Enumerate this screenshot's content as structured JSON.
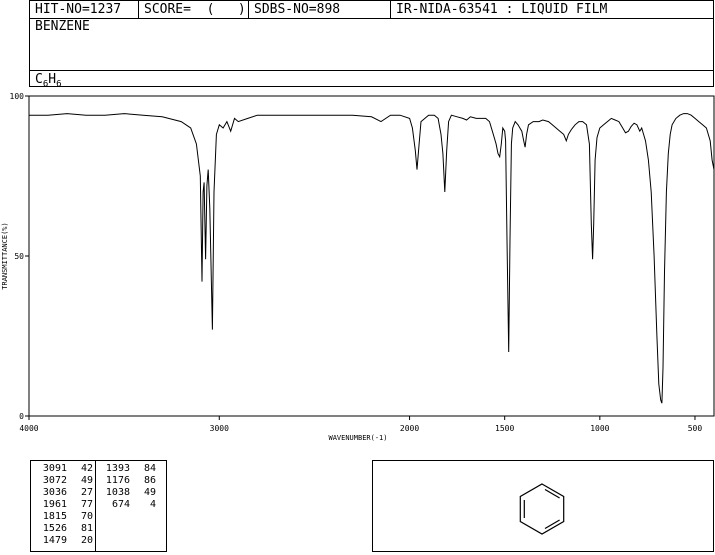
{
  "header": {
    "hit_no": "HIT-NO=1237",
    "score": "SCORE=  (   )",
    "sdbs_no": "SDBS-NO=898",
    "ir_info": "IR-NIDA-63541 : LIQUID FILM",
    "compound_name": "BENZENE",
    "formula": {
      "c": "C",
      "c_sub": "6",
      "h": "H",
      "h_sub": "6"
    }
  },
  "chart_data": {
    "type": "line",
    "xlabel": "WAVENUMBER(-1)",
    "ylabel": "TRANSMITTANCE(%)",
    "xlim": [
      4000,
      400
    ],
    "ylim": [
      0,
      100
    ],
    "x_ticks": [
      4000,
      3000,
      2000,
      1500,
      1000,
      500
    ],
    "y_ticks": [
      0,
      50,
      100
    ],
    "grid": false,
    "baseline": [
      [
        4000,
        94
      ],
      [
        3900,
        94
      ],
      [
        3800,
        94.5
      ],
      [
        3700,
        94
      ],
      [
        3600,
        94
      ],
      [
        3500,
        94.5
      ],
      [
        3400,
        94
      ],
      [
        3300,
        93.5
      ],
      [
        3200,
        92
      ],
      [
        3150,
        90
      ],
      [
        3120,
        85
      ],
      [
        3100,
        75
      ],
      [
        3091,
        42
      ],
      [
        3085,
        70
      ],
      [
        3080,
        73
      ],
      [
        3072,
        49
      ],
      [
        3065,
        72
      ],
      [
        3058,
        77
      ],
      [
        3050,
        65
      ],
      [
        3036,
        27
      ],
      [
        3028,
        70
      ],
      [
        3015,
        88
      ],
      [
        3000,
        91
      ],
      [
        2980,
        90
      ],
      [
        2960,
        92
      ],
      [
        2940,
        89
      ],
      [
        2920,
        93
      ],
      [
        2900,
        92
      ],
      [
        2850,
        93
      ],
      [
        2800,
        94
      ],
      [
        2700,
        94
      ],
      [
        2600,
        94
      ],
      [
        2500,
        94
      ],
      [
        2400,
        94
      ],
      [
        2300,
        94
      ],
      [
        2200,
        93.5
      ],
      [
        2150,
        92
      ],
      [
        2100,
        94
      ],
      [
        2050,
        94
      ],
      [
        2000,
        93
      ],
      [
        1985,
        90
      ],
      [
        1970,
        83
      ],
      [
        1961,
        77
      ],
      [
        1950,
        85
      ],
      [
        1940,
        92
      ],
      [
        1900,
        94
      ],
      [
        1870,
        94
      ],
      [
        1850,
        93
      ],
      [
        1835,
        88
      ],
      [
        1825,
        82
      ],
      [
        1815,
        70
      ],
      [
        1805,
        83
      ],
      [
        1795,
        92
      ],
      [
        1780,
        94
      ],
      [
        1750,
        93.5
      ],
      [
        1720,
        93
      ],
      [
        1700,
        92.5
      ],
      [
        1680,
        93.5
      ],
      [
        1650,
        93
      ],
      [
        1620,
        93
      ],
      [
        1600,
        93
      ],
      [
        1580,
        92
      ],
      [
        1560,
        88
      ],
      [
        1545,
        85
      ],
      [
        1535,
        82
      ],
      [
        1526,
        81
      ],
      [
        1518,
        85
      ],
      [
        1510,
        90
      ],
      [
        1500,
        89
      ],
      [
        1495,
        86
      ],
      [
        1488,
        55
      ],
      [
        1479,
        20
      ],
      [
        1472,
        55
      ],
      [
        1465,
        85
      ],
      [
        1458,
        90
      ],
      [
        1445,
        92
      ],
      [
        1430,
        91
      ],
      [
        1410,
        89
      ],
      [
        1400,
        86
      ],
      [
        1393,
        84
      ],
      [
        1385,
        88
      ],
      [
        1375,
        91
      ],
      [
        1350,
        92
      ],
      [
        1320,
        92
      ],
      [
        1300,
        92.5
      ],
      [
        1270,
        92
      ],
      [
        1250,
        91
      ],
      [
        1230,
        90
      ],
      [
        1210,
        89
      ],
      [
        1190,
        88
      ],
      [
        1176,
        86
      ],
      [
        1165,
        88
      ],
      [
        1150,
        89.5
      ],
      [
        1130,
        91
      ],
      [
        1110,
        92
      ],
      [
        1090,
        92
      ],
      [
        1070,
        91
      ],
      [
        1055,
        85
      ],
      [
        1045,
        60
      ],
      [
        1038,
        49
      ],
      [
        1032,
        60
      ],
      [
        1025,
        80
      ],
      [
        1015,
        87
      ],
      [
        1000,
        90
      ],
      [
        980,
        91
      ],
      [
        960,
        92
      ],
      [
        940,
        93
      ],
      [
        920,
        92.5
      ],
      [
        900,
        92
      ],
      [
        880,
        90
      ],
      [
        865,
        88.5
      ],
      [
        850,
        89
      ],
      [
        835,
        90.5
      ],
      [
        820,
        91.5
      ],
      [
        805,
        91
      ],
      [
        790,
        89
      ],
      [
        780,
        90
      ],
      [
        770,
        88
      ],
      [
        760,
        86
      ],
      [
        745,
        80
      ],
      [
        730,
        70
      ],
      [
        715,
        50
      ],
      [
        700,
        25
      ],
      [
        690,
        10
      ],
      [
        680,
        5
      ],
      [
        674,
        4
      ],
      [
        668,
        15
      ],
      [
        660,
        45
      ],
      [
        650,
        70
      ],
      [
        640,
        82
      ],
      [
        630,
        88
      ],
      [
        620,
        91
      ],
      [
        600,
        93
      ],
      [
        580,
        94
      ],
      [
        560,
        94.5
      ],
      [
        540,
        94.5
      ],
      [
        520,
        94
      ],
      [
        500,
        93
      ],
      [
        480,
        92
      ],
      [
        460,
        91
      ],
      [
        440,
        90
      ],
      [
        420,
        86
      ],
      [
        410,
        80
      ],
      [
        400,
        77
      ]
    ]
  },
  "peaks": [
    {
      "wavenumber": "3091",
      "transmittance": "42"
    },
    {
      "wavenumber": "3072",
      "transmittance": "49"
    },
    {
      "wavenumber": "3036",
      "transmittance": "27"
    },
    {
      "wavenumber": "1961",
      "transmittance": "77"
    },
    {
      "wavenumber": "1815",
      "transmittance": "70"
    },
    {
      "wavenumber": "1526",
      "transmittance": "81"
    },
    {
      "wavenumber": "1479",
      "transmittance": "20"
    },
    {
      "wavenumber": "1393",
      "transmittance": "84"
    },
    {
      "wavenumber": "1176",
      "transmittance": "86"
    },
    {
      "wavenumber": "1038",
      "transmittance": "49"
    },
    {
      "wavenumber": "674",
      "transmittance": "4"
    }
  ],
  "structure": {
    "icon": "benzene-ring-icon"
  }
}
